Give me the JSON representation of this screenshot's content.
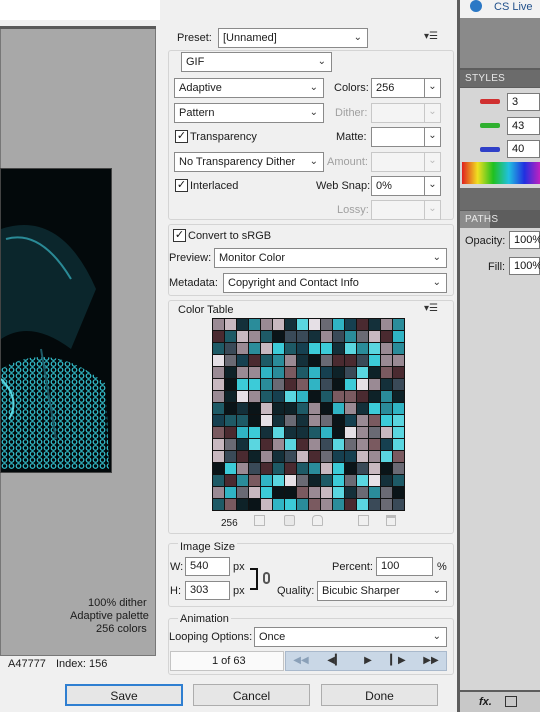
{
  "preset": {
    "label": "Preset:",
    "value": "[Unnamed]"
  },
  "format": {
    "value": "GIF"
  },
  "reduction": {
    "value": "Adaptive"
  },
  "colors": {
    "label": "Colors:",
    "value": "256"
  },
  "dither_algorithm": {
    "value": "Pattern"
  },
  "dither": {
    "label": "Dither:",
    "value": ""
  },
  "transparency": {
    "label": "Transparency",
    "checked": true
  },
  "matte": {
    "label": "Matte:",
    "value": ""
  },
  "transparency_dither": {
    "value": "No Transparency Dither"
  },
  "amount": {
    "label": "Amount:",
    "value": ""
  },
  "interlaced": {
    "label": "Interlaced",
    "checked": true
  },
  "web_snap": {
    "label": "Web Snap:",
    "value": "0%"
  },
  "lossy": {
    "label": "Lossy:",
    "value": ""
  },
  "convert_srgb": {
    "label": "Convert to sRGB",
    "checked": true
  },
  "preview": {
    "label": "Preview:",
    "value": "Monitor Color"
  },
  "metadata": {
    "label": "Metadata:",
    "value": "Copyright and Contact Info"
  },
  "color_table": {
    "title": "Color Table",
    "count": "256"
  },
  "image_size": {
    "title": "Image Size",
    "width_label": "W:",
    "width": "540",
    "width_unit": "px",
    "height_label": "H:",
    "height": "303",
    "height_unit": "px",
    "percent_label": "Percent:",
    "percent": "100",
    "percent_unit": "%",
    "quality_label": "Quality:",
    "quality": "Bicubic Sharper"
  },
  "animation": {
    "title": "Animation",
    "looping_label": "Looping Options:",
    "looping": "Once",
    "frame": "1 of 63"
  },
  "buttons": {
    "save": "Save",
    "cancel": "Cancel",
    "done": "Done"
  },
  "preview_info": {
    "dither": "100% dither",
    "palette": "Adaptive palette",
    "colors": "256 colors"
  },
  "status": {
    "hex": "A47777",
    "index": "Index: 156"
  },
  "ps": {
    "cs_live": "CS Live",
    "styles_tab": "STYLES",
    "r": "3",
    "g": "43",
    "b": "40",
    "paths_tab": "PATHS",
    "opacity_label": "Opacity:",
    "opacity": "100%",
    "fill_label": "Fill:",
    "fill": "100%"
  },
  "colors_used": {
    "swatch_palette": [
      "#0a1418",
      "#14303a",
      "#1e5a66",
      "#2a8c9a",
      "#30b4c4",
      "#3ccbd8",
      "#6a6a74",
      "#9a8a94",
      "#c8b8c0",
      "#e6e0e6",
      "#4a2a30",
      "#7a5a60",
      "#164050",
      "#0e2228",
      "#5ad6e0",
      "#3a4a58"
    ]
  }
}
